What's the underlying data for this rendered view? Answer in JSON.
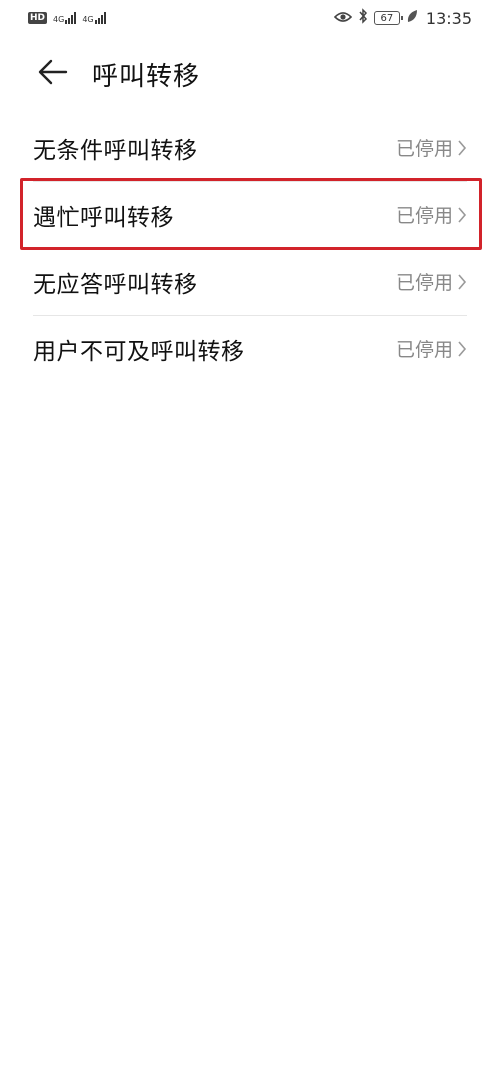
{
  "status_bar": {
    "hd_badge": "HD",
    "sim1_net": "4G",
    "sim2_net": "4G",
    "battery": "67",
    "time": "13:35"
  },
  "header": {
    "title": "呼叫转移"
  },
  "list": {
    "items": [
      {
        "label": "无条件呼叫转移",
        "status": "已停用"
      },
      {
        "label": "遇忙呼叫转移",
        "status": "已停用"
      },
      {
        "label": "无应答呼叫转移",
        "status": "已停用"
      },
      {
        "label": "用户不可及呼叫转移",
        "status": "已停用"
      }
    ]
  },
  "colors": {
    "highlight": "#d2232a",
    "secondary_text": "#888888",
    "divider": "#e6e6e6"
  },
  "icons": [
    "back-arrow-icon",
    "chevron-right-icon",
    "eye-icon",
    "bluetooth-icon",
    "leaf-icon",
    "battery-icon",
    "signal-icon"
  ]
}
